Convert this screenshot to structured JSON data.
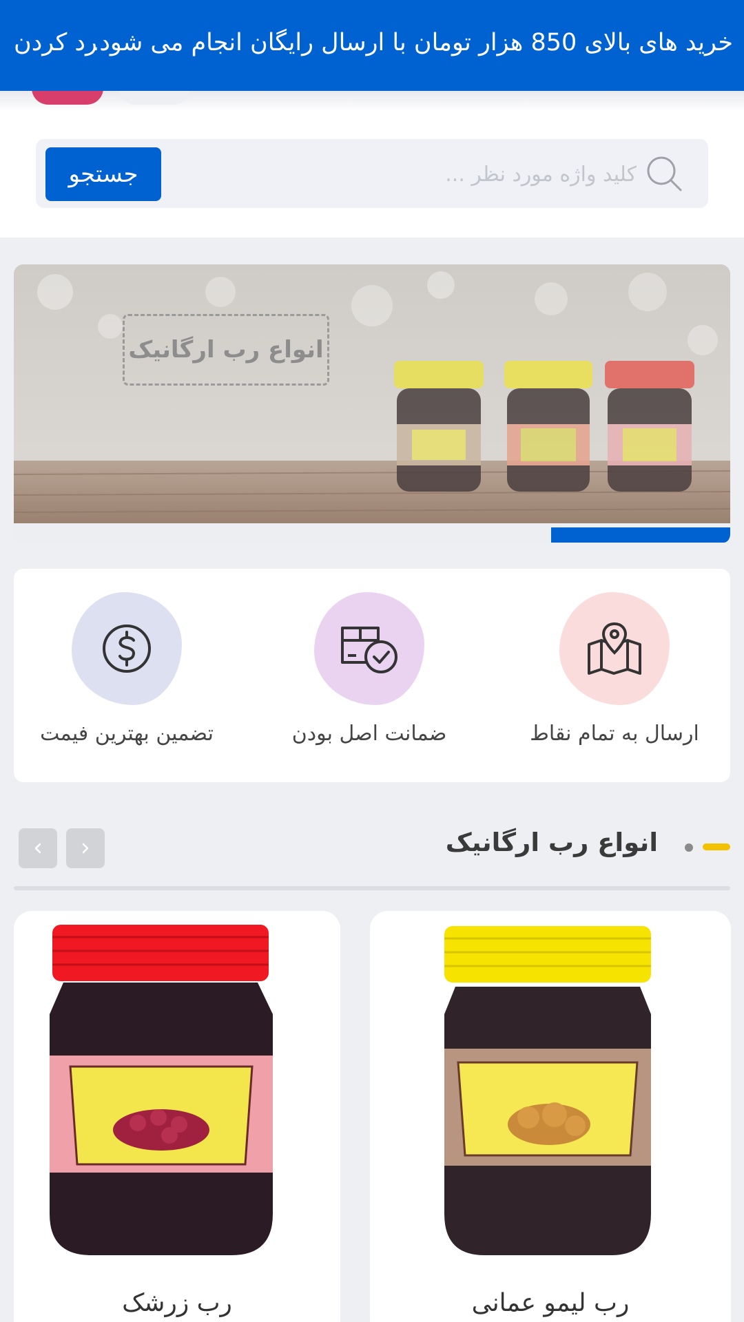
{
  "notice": {
    "text": "خرید های بالای 850 هزار تومان با ارسال رایگان انجام می شود.",
    "close_label": "رد کردن"
  },
  "search": {
    "placeholder": "کلید واژه مورد نظر ...",
    "button_label": "جستجو"
  },
  "banner": {
    "title": "انواع رب ارگانیک",
    "progress": 0.25
  },
  "features": [
    {
      "label": "ارسال به تمام نقاط",
      "icon": "map-pin-icon",
      "color": "#fbdcdc"
    },
    {
      "label": "ضمانت اصل بودن",
      "icon": "box-check-icon",
      "color": "#e9d3f1"
    },
    {
      "label": "تضمین بهترین فیمت",
      "icon": "dollar-icon",
      "color": "#dde0f0"
    }
  ],
  "section": {
    "title": "انواع رب ارگانیک"
  },
  "products": [
    {
      "name": "رب لیمو عمانی",
      "lid_color": "#f6e400",
      "label_color": "#b89580"
    },
    {
      "name": "رب زرشک",
      "lid_color": "#f01822",
      "label_color": "#f0a0a8"
    }
  ],
  "colors": {
    "primary": "#0062d0",
    "accent_pink": "#d73f6a",
    "accent_yellow": "#f2c200"
  }
}
